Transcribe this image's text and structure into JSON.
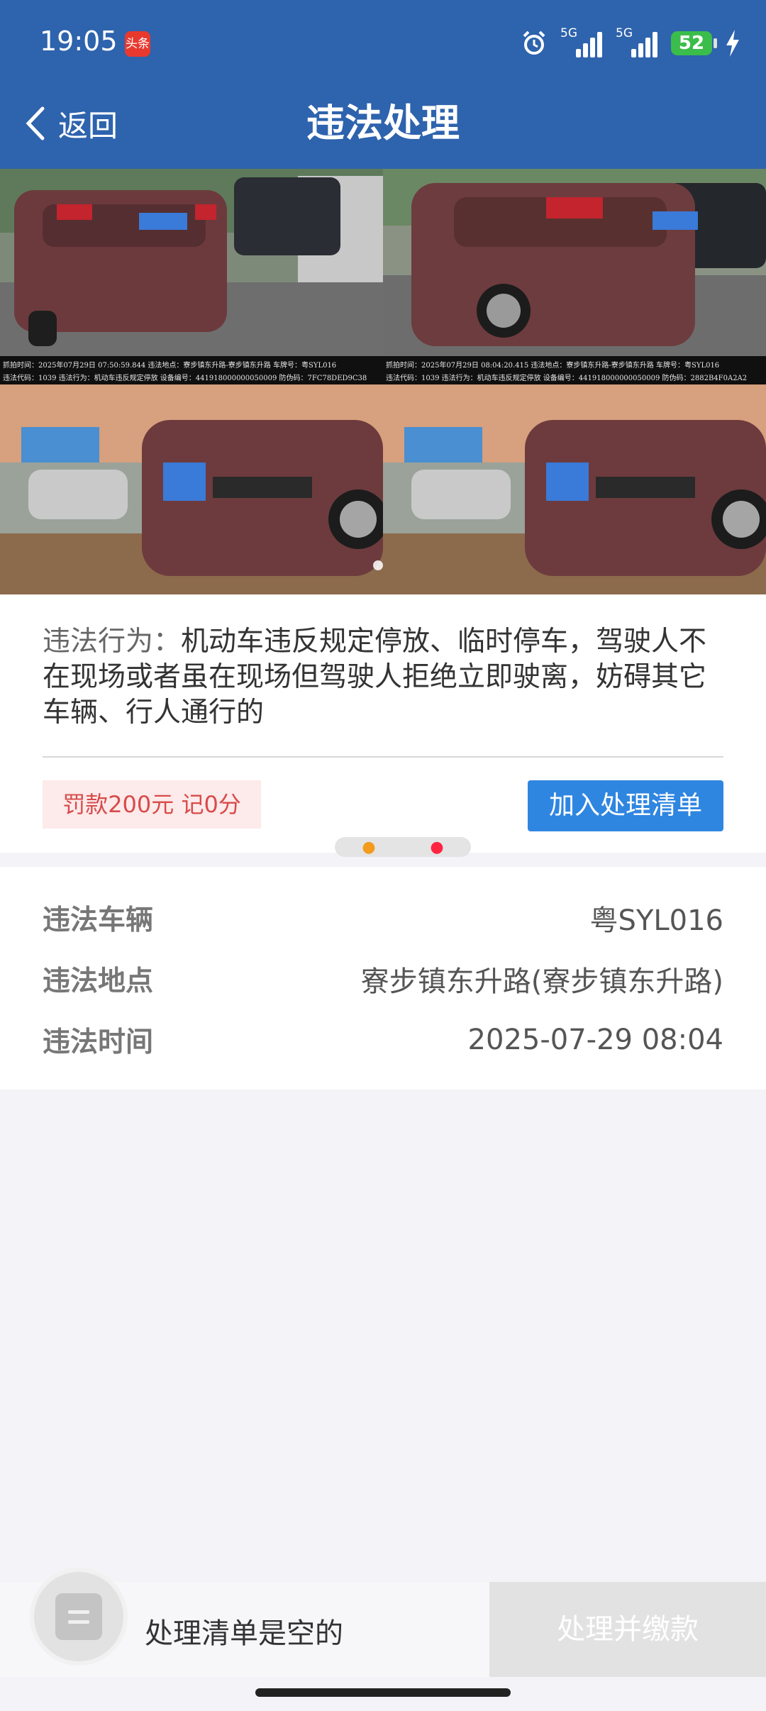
{
  "status_bar": {
    "time": "19:05",
    "app_badge": "头条",
    "network_1": "5G",
    "network_2": "5G",
    "battery": "52",
    "icons": [
      "alarm-icon",
      "signal-icon",
      "signal-icon",
      "battery-icon",
      "charging-bolt-icon"
    ]
  },
  "header": {
    "back_label": "返回",
    "title": "违法处理"
  },
  "photos": {
    "captions": [
      "抓拍时间：2025年07月29日 07:50:59.844  违法地点：寮步镇东升路-寮步镇东升路  车牌号：粤SYL016",
      "违法代码：1039  违法行为：机动车违反规定停放  设备编号：441918000000050009  防伪码：7FC78DED9C38",
      "抓拍时间：2025年07月29日 08:04:20.415  违法地点：寮步镇东升路-寮步镇东升路  车牌号：粤SYL016",
      "违法代码：1039  违法行为：机动车违反规定停放  设备编号：441918000000050009  防伪码：2882B4F0A2A2"
    ]
  },
  "violation": {
    "label": "违法行为：",
    "text": "机动车违反规定停放、临时停车，驾驶人不在现场或者虽在现场但驾驶人拒绝立即驶离，妨碍其它车辆、行人通行的",
    "penalty": "罚款200元 记0分",
    "add_button": "加入处理清单"
  },
  "details": {
    "rows": [
      {
        "label": "违法车辆",
        "value": "粤SYL016"
      },
      {
        "label": "违法地点",
        "value": "寮步镇东升路(寮步镇东升路)"
      },
      {
        "label": "违法时间",
        "value": "2025-07-29 08:04"
      }
    ]
  },
  "bottom": {
    "empty_text": "处理清单是空的",
    "pay_button": "处理并缴款"
  },
  "colors": {
    "header_blue": "#2e63ad",
    "button_blue": "#2f86e0",
    "penalty_red": "#d84b4b",
    "penalty_bg": "#fdeaea",
    "disabled_gray": "#e2e2e2"
  }
}
